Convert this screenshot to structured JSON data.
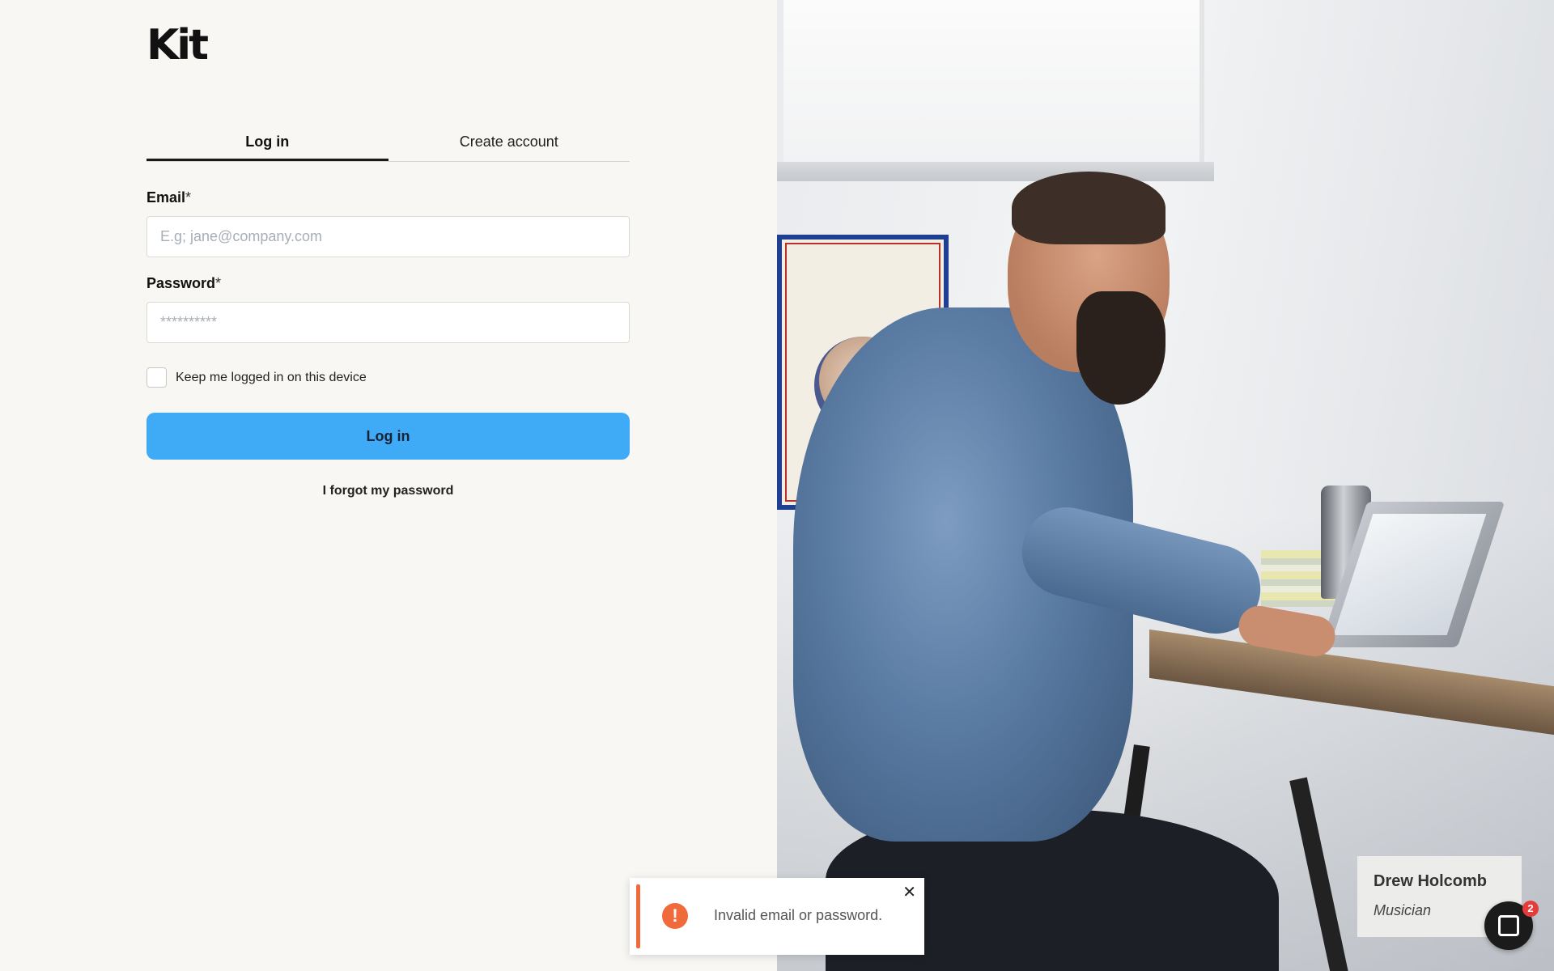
{
  "brand": {
    "logo_text": "Kit"
  },
  "tabs": [
    {
      "label": "Log in",
      "active": true
    },
    {
      "label": "Create account",
      "active": false
    }
  ],
  "form": {
    "email_label": "Email",
    "email_required": "*",
    "email_placeholder": "E.g; jane@company.com",
    "email_value": "",
    "password_label": "Password",
    "password_required": "*",
    "password_placeholder": "**********",
    "password_value": "",
    "remember_label": "Keep me logged in on this device",
    "remember_checked": false,
    "submit_label": "Log in",
    "forgot_label": "I forgot my password"
  },
  "testimonial": {
    "name": "Drew Holcomb",
    "role": "Musician"
  },
  "toast": {
    "message": "Invalid email or password.",
    "close_icon": "close-icon",
    "status_icon": "alert-icon",
    "status_glyph": "!",
    "accent_color": "#f06a3c"
  },
  "chat": {
    "badge_count": "2"
  },
  "colors": {
    "primary_button": "#3fabf7",
    "background": "#f8f7f4"
  }
}
